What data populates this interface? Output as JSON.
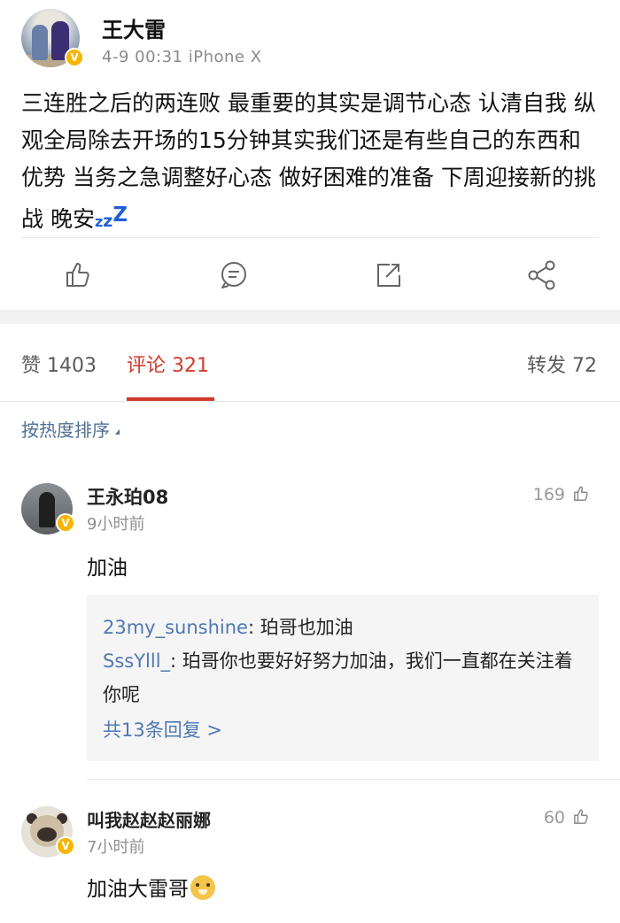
{
  "post": {
    "author": "王大雷",
    "meta": "4-9 00:31  iPhone X",
    "text": "三连胜之后的两连败 最重要的其实是调节心态 认清自我 纵观全局除去开场的15分钟其实我们还是有些自己的东西和优势 当务之急调整好心态 做好困难的准备 下周迎接新的挑战 晚安",
    "zzz": [
      "z",
      "z",
      "Z"
    ],
    "verified_badge": "V"
  },
  "actions": [
    {
      "icon": "thumbs-up-icon"
    },
    {
      "icon": "comment-icon"
    },
    {
      "icon": "repost-icon"
    },
    {
      "icon": "share-icon"
    }
  ],
  "tabs": {
    "likes": "赞 1403",
    "comments": "评论 321",
    "reposts": "转发 72"
  },
  "sort_label": "按热度排序",
  "comments": [
    {
      "name": "王永珀08",
      "time": "9小时前",
      "likes": "169",
      "text": "加油",
      "replies": [
        {
          "user": "23my_sunshine",
          "text": ": 珀哥也加油"
        },
        {
          "user": "SssYlll_",
          "text": ": 珀哥你也要好好努力加油，我们一直都在关注着你呢"
        }
      ],
      "more": "共13条回复 >"
    },
    {
      "name": "叫我赵赵赵丽娜",
      "time": "7小时前",
      "likes": "60",
      "text": "加油大雷哥"
    }
  ],
  "colors": {
    "accent_red": "#d03a2c",
    "link_blue": "#4f78b3",
    "badge_gold": "#f7b500"
  }
}
